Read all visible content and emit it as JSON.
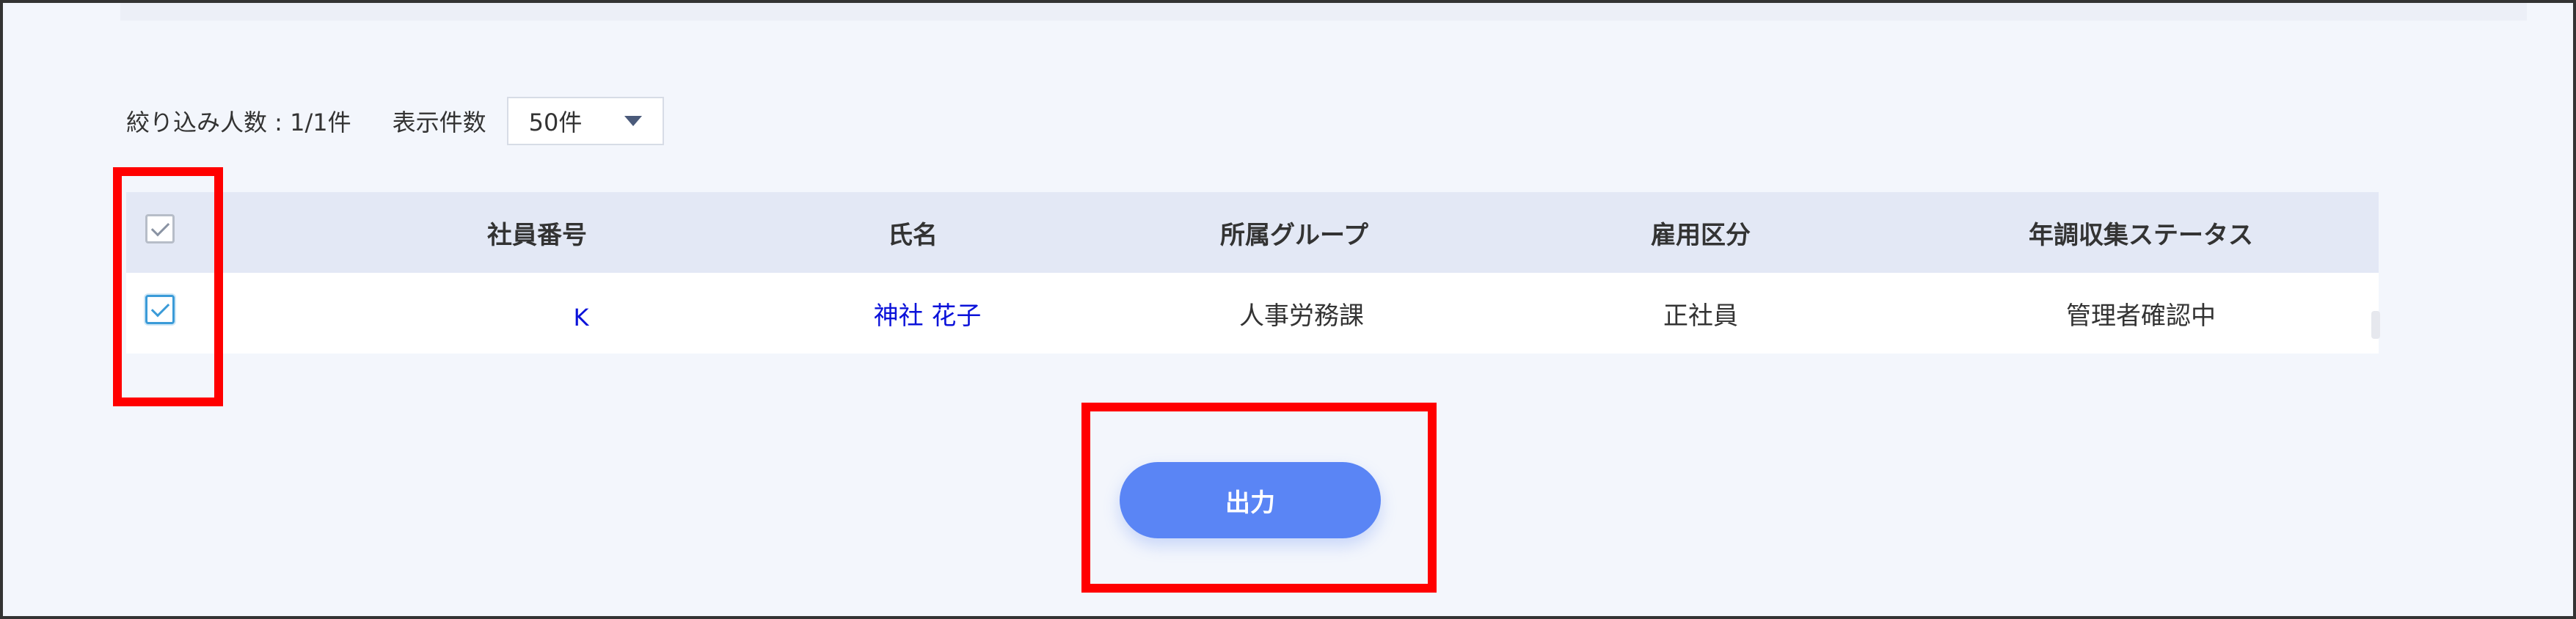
{
  "filter": {
    "count_text": "絞り込み人数 : 1/1件",
    "per_page_label": "表示件数",
    "per_page_value": "50件"
  },
  "table": {
    "headers": {
      "employee_no": "社員番号",
      "name": "氏名",
      "group": "所属グループ",
      "employment_type": "雇用区分",
      "status": "年調収集ステータス"
    },
    "rows": [
      {
        "checked": true,
        "employee_no": "K",
        "name": "神社 花子",
        "group": "人事労務課",
        "employment_type": "正社員",
        "status": "管理者確認中"
      }
    ]
  },
  "actions": {
    "export_label": "出力"
  },
  "colors": {
    "accent": "#5a85f5",
    "link": "#0b12d9",
    "highlight": "#ff0000",
    "header_bg": "#e3e8f5"
  }
}
